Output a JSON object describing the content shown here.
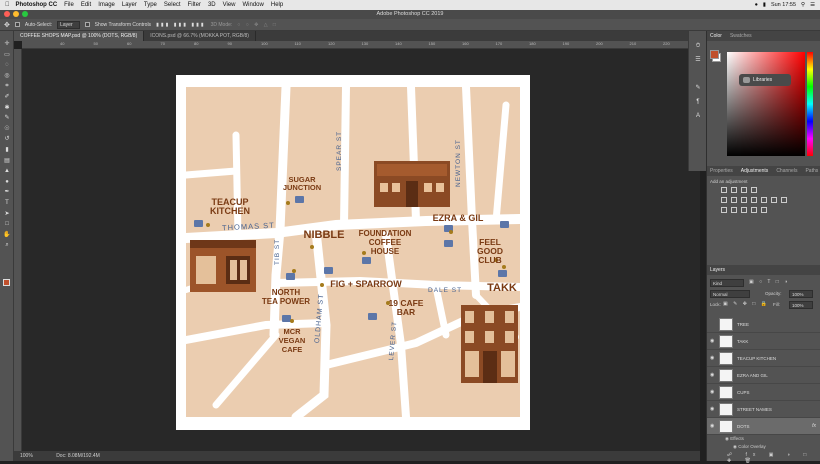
{
  "menubar": {
    "app": "Photoshop CC",
    "items": [
      "File",
      "Edit",
      "Image",
      "Layer",
      "Type",
      "Select",
      "Filter",
      "3D",
      "View",
      "Window",
      "Help"
    ],
    "clock": "Sun 17:55"
  },
  "window": {
    "title": "Adobe Photoshop CC 2019"
  },
  "options": {
    "auto_select": "Auto-Select:",
    "layer_select": "Layer",
    "transform": "Show Transform Controls",
    "mode3d": "3D Mode:"
  },
  "tabs": [
    {
      "label": "COFFEE SHOPS MAP.psd @ 100% (DOTS, RGB/8)",
      "active": true
    },
    {
      "label": "ICONS.psd @ 66.7% (MOKKA POT, RGB/8)",
      "active": false
    }
  ],
  "status": {
    "zoom": "100%",
    "doc": "Doc: 8.08M/192.4M"
  },
  "ruler_top": [
    "40",
    "50",
    "60",
    "70",
    "80",
    "90",
    "100",
    "110",
    "120",
    "130",
    "140",
    "150",
    "160",
    "170",
    "180",
    "190",
    "200",
    "210",
    "220",
    "230"
  ],
  "panels": {
    "color_tabs": [
      "Color",
      "Swatches"
    ],
    "libraries": "Libraries",
    "adj_tabs": [
      "Properties",
      "Adjustments",
      "Channels",
      "Paths"
    ],
    "adj_hint": "Add an adjustment",
    "layers_title": "Layers",
    "kind": "Kind",
    "blend": "Normal",
    "opacity_label": "Opacity:",
    "opacity": "100%",
    "lock_label": "Lock:",
    "fill_label": "Fill:",
    "fill": "100%",
    "layers": [
      "TREE",
      "TAKK",
      "TEACUP KITCHEN",
      "EZRA AND GIL",
      "CUPS",
      "STREET NAMES",
      "DOTS"
    ],
    "effects": "Effects",
    "color_overlay": "Color Overlay"
  },
  "map": {
    "places": {
      "sugar": "SUGAR\nJUNCTION",
      "teacup": "TEACUP\nKITCHEN",
      "nibble": "NIBBLE",
      "foundation": "FOUNDATION\nCOFFEE\nHOUSE",
      "ezra": "EZRA & GIL",
      "feel": "FEEL\nGOOD\nCLUB",
      "takk": "TAKK",
      "north": "NORTH\nTEA POWER",
      "fig": "FIG + SPARROW",
      "cafe19": "19 CAFE\nBAR",
      "mcr": "MCR\nVEGAN\nCAFE"
    },
    "streets": {
      "thomas": "THOMAS ST",
      "spear": "SPEAR ST",
      "newton": "NEWTON ST",
      "tib": "TIB ST",
      "oldham": "OLDHAM ST",
      "dale": "DALE ST",
      "lever": "LEVER ST"
    },
    "shop_sign": "Paper"
  }
}
